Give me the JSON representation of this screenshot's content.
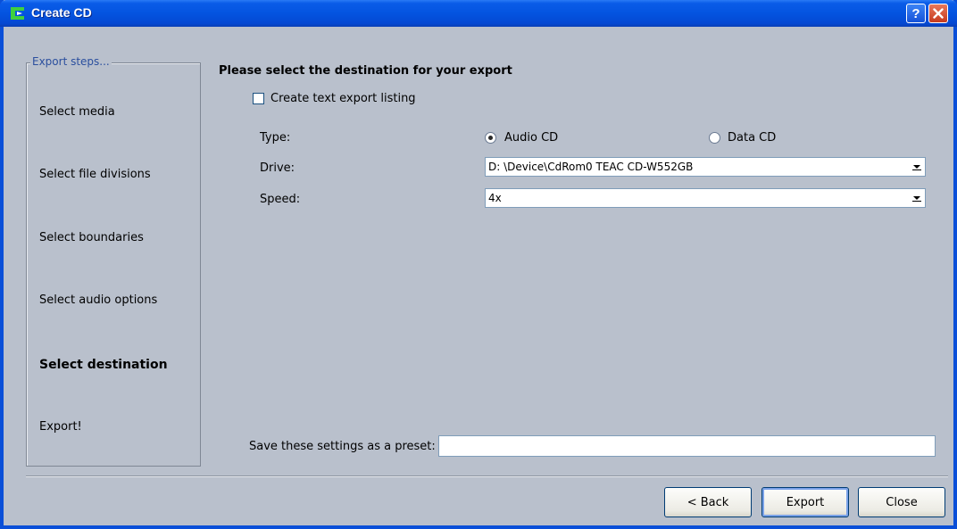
{
  "window": {
    "title": "Create CD",
    "icons": {
      "app": "create-cd-app-icon",
      "help": "help-icon",
      "close": "close-icon"
    },
    "colors": {
      "titlebar": "#0454e0",
      "body": "#b9c0cc",
      "legend": "#2b4f9e"
    }
  },
  "steps": {
    "legend": "Export steps...",
    "items": [
      {
        "label": "Select media"
      },
      {
        "label": "Select file divisions"
      },
      {
        "label": "Select boundaries"
      },
      {
        "label": "Select audio options"
      },
      {
        "label": "Select destination",
        "active": true
      },
      {
        "label": "Export!"
      }
    ]
  },
  "main": {
    "heading": "Please select the destination for your export",
    "text_export_checkbox": {
      "label": "Create text export listing",
      "checked": false
    },
    "type": {
      "label": "Type:",
      "options": [
        {
          "label": "Audio CD",
          "selected": true
        },
        {
          "label": "Data CD",
          "selected": false
        }
      ]
    },
    "drive": {
      "label": "Drive:",
      "value": "D:  \\Device\\CdRom0  TEAC  CD-W552GB"
    },
    "speed": {
      "label": "Speed:",
      "value": "4x"
    },
    "preset": {
      "label": "Save these settings as a preset:",
      "value": ""
    }
  },
  "buttons": {
    "back": "< Back",
    "export": "Export",
    "close": "Close"
  }
}
